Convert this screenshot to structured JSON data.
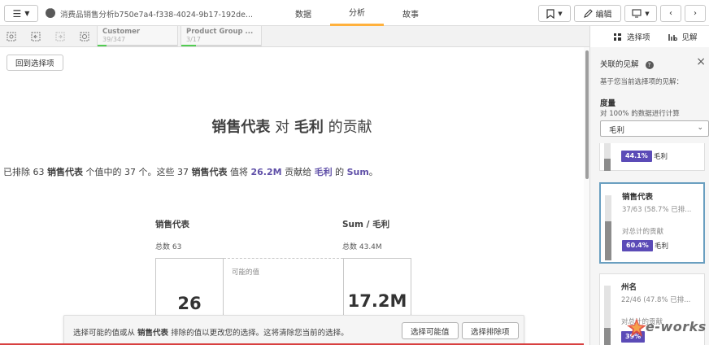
{
  "topbar": {
    "app_title": "消费品销售分析b750e7a4-f338-4024-9b17-192de...",
    "tabs": [
      {
        "label": "数据",
        "active": false
      },
      {
        "label": "分析",
        "active": true
      },
      {
        "label": "故事",
        "active": false
      }
    ],
    "edit_label": "编辑"
  },
  "selection_bar": {
    "chips": [
      {
        "name": "Customer",
        "count": "39/347",
        "fill": 0.11
      },
      {
        "name": "Product Group ...",
        "count": "3/17",
        "fill": 0.18
      }
    ],
    "right_tabs": [
      {
        "label": "选择项"
      },
      {
        "label": "见解"
      }
    ]
  },
  "main": {
    "back_button": "回到选择项",
    "heading": {
      "dim": "销售代表",
      "mid": " 对 ",
      "measure": "毛利",
      "tail": " 的贡献"
    },
    "sentence": {
      "p1": "已排除 63 ",
      "dim1": "销售代表",
      "p2": " 个值中的 37 个。这些 37 ",
      "dim2": "销售代表",
      "p3": " 值将 ",
      "value": "26.2M",
      "p4": " 贡献给 ",
      "measure": "毛利",
      "p5": " 的 ",
      "agg": "Sum",
      "p6": "。"
    },
    "left_col": {
      "title": "销售代表",
      "subtitle": "总数 63"
    },
    "right_col": {
      "title": "Sum / 毛利",
      "subtitle": "总数 43.4M"
    },
    "possible_label": "可能的值",
    "left_number": "26",
    "right_number": "17.2M"
  },
  "toast": {
    "text_pre": "选择可能的值或从 ",
    "text_dim": "销售代表",
    "text_post": " 排除的值以更改您的选择。这将清除您当前的选择。",
    "btn_possible": "选择可能值",
    "btn_excluded": "选择排除项"
  },
  "panel": {
    "title": "关联的见解",
    "help": "?",
    "desc": "基于您当前选择项的见解：",
    "measure_heading": "度量",
    "calc_note": "对 100% 的数据进行计算",
    "select_value": "毛利",
    "cards": [
      {
        "name": "",
        "stat": "",
        "contrib": "",
        "pill": "44.1%",
        "pill_label": "毛利",
        "fill": 0.44
      },
      {
        "name": "销售代表",
        "stat": "37/63 (58.7% 已排...",
        "contrib": "对总计的贡献",
        "pill": "60.4%",
        "pill_label": "毛利",
        "fill": 0.6
      },
      {
        "name": "州名",
        "stat": "22/46 (47.8% 已排...",
        "contrib": "对总计的贡献",
        "pill": "39%",
        "pill_label": "毛利",
        "fill": 0.39
      }
    ]
  },
  "watermark": {
    "text": "e-works"
  },
  "colors": {
    "accent_tab": "#ffb13d",
    "pill": "#5b4bb7",
    "selection_green": "#52cc52",
    "highlight_text": "#6050a8"
  }
}
